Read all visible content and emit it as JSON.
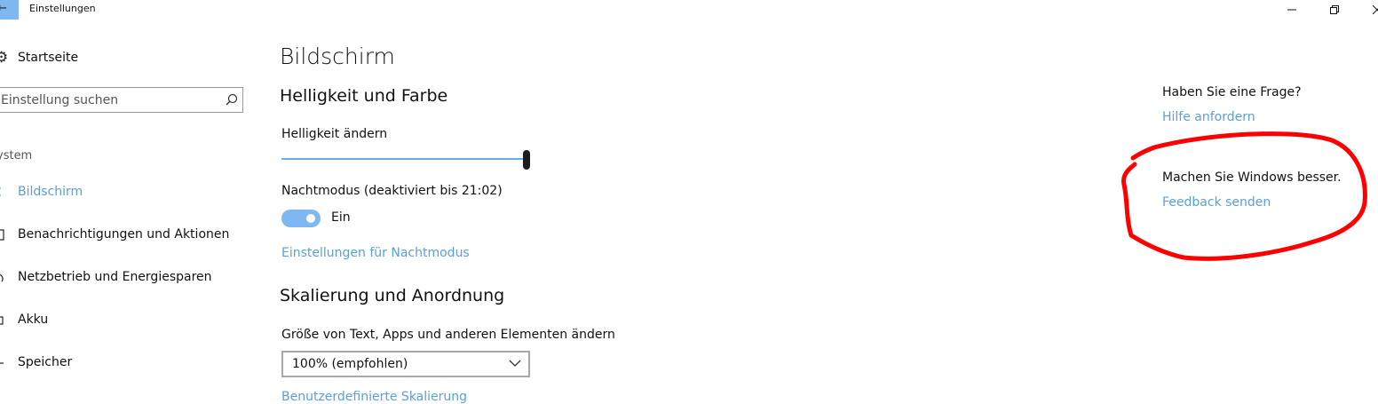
{
  "window": {
    "title": "Einstellungen"
  },
  "sidebar": {
    "home_label": "Startseite",
    "search_placeholder": "Einstellung suchen",
    "section_label": "ystem",
    "items": [
      {
        "label": "Bildschirm",
        "active": true
      },
      {
        "label": "Benachrichtigungen und Aktionen",
        "active": false
      },
      {
        "label": "Netzbetrieb und Energiesparen",
        "active": false
      },
      {
        "label": "Akku",
        "active": false
      },
      {
        "label": "Speicher",
        "active": false
      }
    ]
  },
  "main": {
    "page_title": "Bildschirm",
    "brightness_section": {
      "heading": "Helligkeit und Farbe",
      "brightness_label": "Helligkeit ändern",
      "brightness_value": 1.0,
      "night_mode_label": "Nachtmodus (deaktiviert bis 21:02)",
      "night_mode_state": "Ein",
      "night_mode_on": true,
      "night_mode_settings_link": "Einstellungen für Nachtmodus"
    },
    "scaling_section": {
      "heading": "Skalierung und Anordnung",
      "size_label": "Größe von Text, Apps und anderen Elementen ändern",
      "size_selected": "100% (empfohlen)",
      "custom_scaling_link": "Benutzerdefinierte Skalierung"
    }
  },
  "right_panel": {
    "question_heading": "Haben Sie eine Frage?",
    "help_link": "Hilfe anfordern",
    "feedback_heading": "Machen Sie Windows besser.",
    "feedback_link": "Feedback senden"
  },
  "colors": {
    "accent": "#5a9fd8",
    "toggle_on": "#7fb8f0",
    "annotation": "#ff0000"
  }
}
